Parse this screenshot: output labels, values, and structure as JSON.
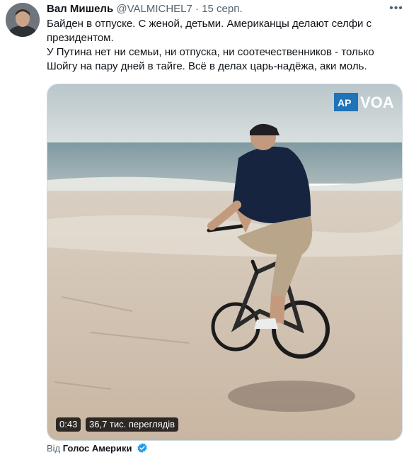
{
  "tweet": {
    "author_name": "Вал Мишель",
    "author_handle": "@VALMICHEL7",
    "separator": "·",
    "date": "15 серп.",
    "more_icon": "more-horizontal-icon",
    "text_lines": [
      "Байден в отпуске. С женой, детьми. Американцы делают селфи с президентом.",
      "У Путина нет ни семьи, ни отпуска, ни соотечественников - только Шойгу на пару дней в тайге. Всё в делах царь-надёжа, аки моль."
    ]
  },
  "video": {
    "duration": "0:43",
    "views": "36,7 тис. переглядів",
    "watermark_ap": "AP",
    "watermark_voa": "VOA"
  },
  "source": {
    "label": "Від",
    "name": "Голос Америки",
    "verified_icon": "verified-badge-icon",
    "verified_color": "#1d9bf0"
  },
  "colors": {
    "text_primary": "#0f1419",
    "text_secondary": "#536471",
    "border": "#cfd9de",
    "accent": "#1d9bf0"
  }
}
